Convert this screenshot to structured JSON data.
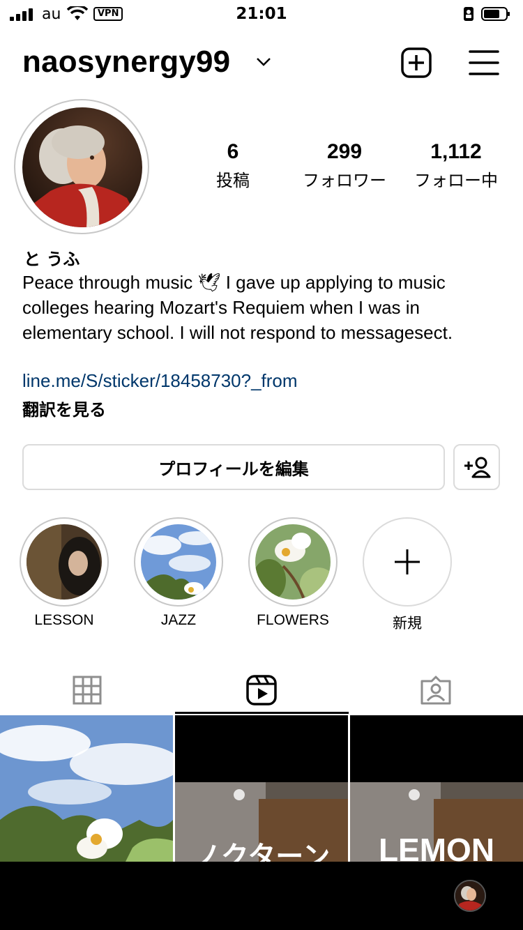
{
  "status_bar": {
    "carrier": "au",
    "vpn": "VPN",
    "time": "21:01"
  },
  "header": {
    "username": "naosynergy99"
  },
  "stats": [
    {
      "num": "6",
      "label": "投稿"
    },
    {
      "num": "299",
      "label": "フォロワー"
    },
    {
      "num": "1,112",
      "label": "フォロー中"
    }
  ],
  "bio": {
    "name": "と うふ",
    "text_1": "Peace through music ",
    "emoji": "🕊",
    "text_2": " I gave up applying to music colleges hearing Mozart's Requiem when I was in elementary school. I will not respond to messagesect.",
    "link": "line.me/S/sticker/18458730?_from",
    "translate": "翻訳を見る"
  },
  "buttons": {
    "edit_profile": "プロフィールを編集"
  },
  "highlights": [
    {
      "label": "LESSON"
    },
    {
      "label": "JAZZ"
    },
    {
      "label": "FLOWERS"
    },
    {
      "label": "新規"
    }
  ],
  "tabs": [
    "posts-grid",
    "reels",
    "tagged"
  ],
  "grid": {
    "items": [
      {
        "overlay": ""
      },
      {
        "overlay": "ノクターン"
      },
      {
        "overlay": "LEMON"
      }
    ]
  },
  "colors": {
    "link": "#00376b",
    "border": "#dbdbdb"
  }
}
